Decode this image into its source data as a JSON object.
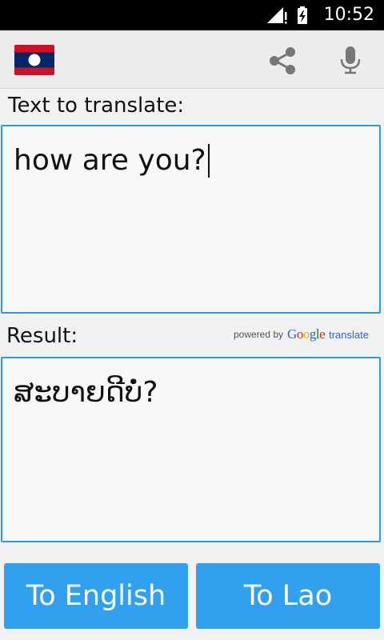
{
  "status_bar": {
    "time": "10:52"
  },
  "app_bar": {
    "flag_colors": {
      "red": "#ce1126",
      "blue": "#002868",
      "white": "#ffffff"
    },
    "share_icon": "share-icon",
    "mic_icon": "microphone-icon"
  },
  "input": {
    "label": "Text to translate:",
    "value": "how are you?"
  },
  "result": {
    "label": "Result:",
    "value": "ສະບາຍດີບໍ່?"
  },
  "attribution": {
    "powered_by": "powered by",
    "google_letters": [
      "G",
      "o",
      "o",
      "g",
      "l",
      "e"
    ],
    "translate": "translate"
  },
  "buttons": {
    "to_english": "To English",
    "to_lao": "To Lao"
  },
  "colors": {
    "accent": "#31a0ee",
    "box_border": "#2e9be0"
  }
}
